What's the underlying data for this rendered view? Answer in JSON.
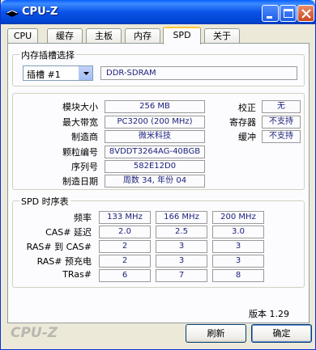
{
  "window": {
    "title": "CPU-Z"
  },
  "tabs": [
    "CPU",
    "缓存",
    "主板",
    "内存",
    "SPD",
    "关于"
  ],
  "active_tab": "SPD",
  "slot_group": {
    "title": "内存插槽选择",
    "slot_value": "插槽 #1",
    "memory_type": "DDR-SDRAM"
  },
  "module": {
    "labels": {
      "size": "模块大小",
      "bandwidth": "最大带宽",
      "manufacturer": "制造商",
      "part_number": "颗粒编号",
      "serial": "序列号",
      "date": "制造日期",
      "ecc": "校正",
      "registered": "寄存器",
      "buffered": "缓冲"
    },
    "values": {
      "size": "256 MB",
      "bandwidth": "PC3200 (200 MHz)",
      "manufacturer": "微米科技",
      "part_number": "8VDDT3264AG-40BGB",
      "serial": "582E12D0",
      "date": "周数 34, 年份 04",
      "ecc": "无",
      "registered": "不支持",
      "buffered": "不支持"
    }
  },
  "timing": {
    "title": "SPD 时序表",
    "row_labels": [
      "频率",
      "CAS# 延迟",
      "RAS# 到 CAS#",
      "RAS# 预充电",
      "TRas#"
    ],
    "rows": [
      [
        "133 MHz",
        "166 MHz",
        "200 MHz"
      ],
      [
        "2.0",
        "2.5",
        "3.0"
      ],
      [
        "2",
        "3",
        "3"
      ],
      [
        "2",
        "3",
        "3"
      ],
      [
        "6",
        "7",
        "8"
      ]
    ]
  },
  "footer": {
    "version": "版本 1.29",
    "brand": "CPU-Z",
    "refresh_label": "刷新",
    "ok_label": "确定"
  },
  "colors": {
    "title_bar": "#0a52e8",
    "value_text": "#1a1f7a"
  }
}
